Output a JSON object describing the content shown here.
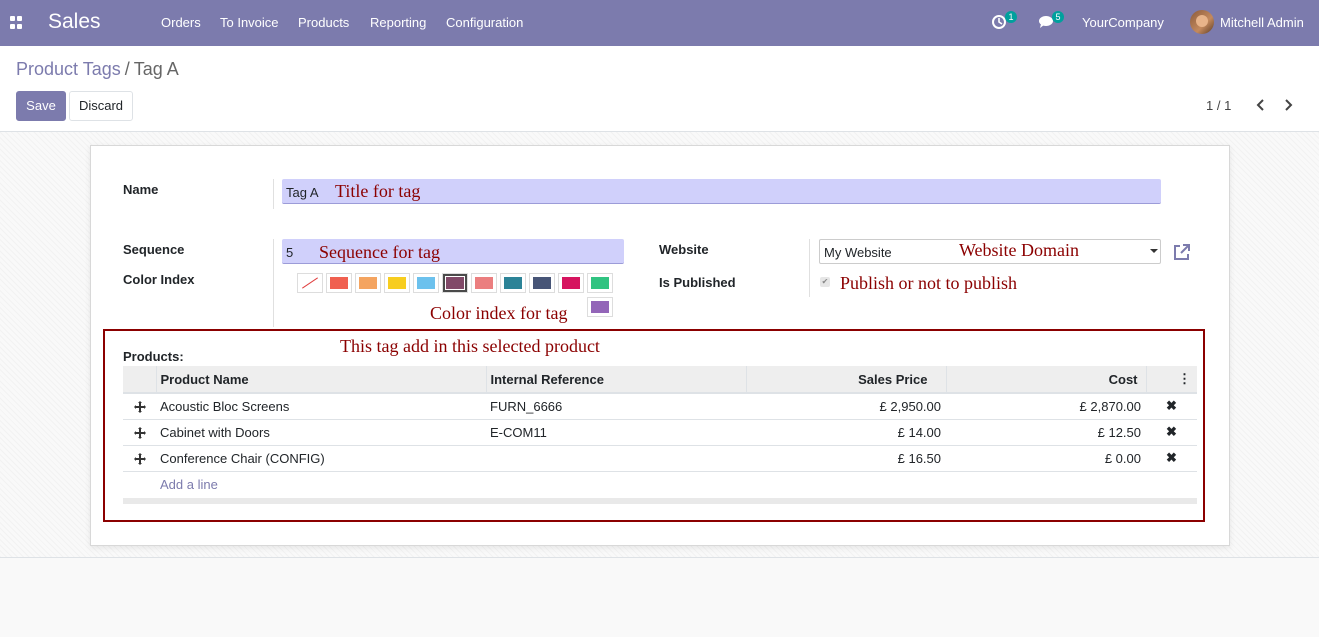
{
  "navbar": {
    "app_name": "Sales",
    "menu": [
      "Orders",
      "To Invoice",
      "Products",
      "Reporting",
      "Configuration"
    ],
    "activity_count": "1",
    "message_count": "5",
    "company": "YourCompany",
    "user": "Mitchell Admin",
    "accent_color": "#7c7bad"
  },
  "breadcrumb": {
    "parent": "Product Tags",
    "current": "Tag A"
  },
  "buttons": {
    "save": "Save",
    "discard": "Discard"
  },
  "pager": {
    "value": "1 / 1"
  },
  "form": {
    "name_label": "Name",
    "name_value": "Tag A",
    "sequence_label": "Sequence",
    "sequence_value": "5",
    "color_label": "Color Index",
    "colors": [
      "none",
      "#f06050",
      "#f4a460",
      "#f7cd1f",
      "#6cc1ed",
      "#814968",
      "#eb7e7f",
      "#2c8397",
      "#475577",
      "#d6145f",
      "#30c381",
      "#9365b8"
    ],
    "selected_color_index": 5,
    "website_label": "Website",
    "website_value": "My Website",
    "published_label": "Is Published",
    "published": true,
    "products_label": "Products:"
  },
  "annotations": {
    "title": "Title for tag",
    "sequence": "Sequence for tag",
    "color": "Color index for tag",
    "website": "Website Domain",
    "publish": "Publish or not to publish",
    "products": "This tag add in this selected product"
  },
  "table": {
    "columns": [
      "Product Name",
      "Internal Reference",
      "Sales Price",
      "Cost"
    ],
    "rows": [
      {
        "name": "Acoustic Bloc Screens",
        "ref": "FURN_6666",
        "price": "£ 2,950.00",
        "cost": "£ 2,870.00"
      },
      {
        "name": "Cabinet with Doors",
        "ref": "E-COM11",
        "price": "£ 14.00",
        "cost": "£ 12.50"
      },
      {
        "name": "Conference Chair (CONFIG)",
        "ref": "",
        "price": "£ 16.50",
        "cost": "£ 0.00"
      }
    ],
    "add_line": "Add a line"
  }
}
